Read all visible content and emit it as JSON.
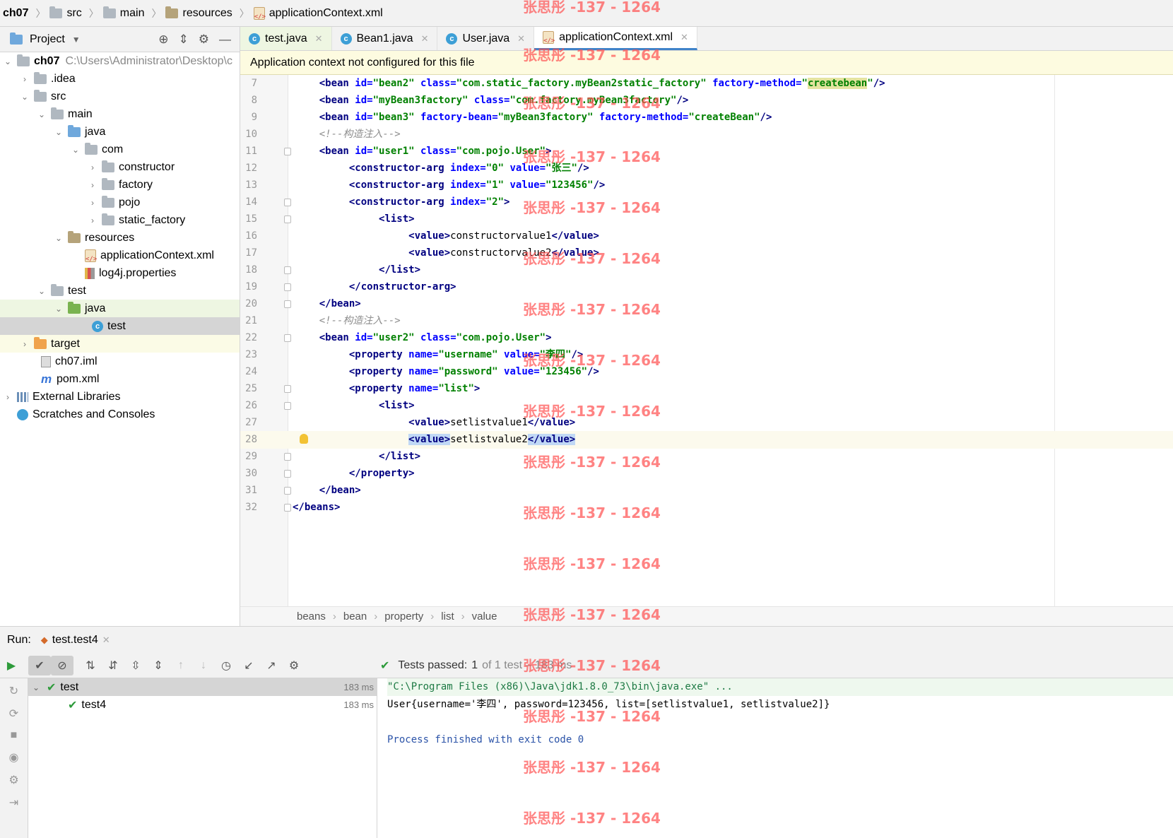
{
  "breadcrumb": {
    "items": [
      "ch07",
      "src",
      "main",
      "resources",
      "applicationContext.xml"
    ]
  },
  "project": {
    "title": "Project",
    "tree": [
      {
        "label": "ch07",
        "path": "C:\\Users\\Administrator\\Desktop\\c",
        "icon": "module-folder-icon"
      },
      {
        "label": ".idea",
        "icon": "folder-icon"
      },
      {
        "label": "src",
        "icon": "folder-icon"
      },
      {
        "label": "main",
        "icon": "folder-icon"
      },
      {
        "label": "java",
        "icon": "source-folder-icon"
      },
      {
        "label": "com",
        "icon": "package-icon"
      },
      {
        "label": "constructor",
        "icon": "package-icon"
      },
      {
        "label": "factory",
        "icon": "package-icon"
      },
      {
        "label": "pojo",
        "icon": "package-icon"
      },
      {
        "label": "static_factory",
        "icon": "package-icon"
      },
      {
        "label": "resources",
        "icon": "resources-folder-icon"
      },
      {
        "label": "applicationContext.xml",
        "icon": "xml-file-icon"
      },
      {
        "label": "log4j.properties",
        "icon": "properties-file-icon"
      },
      {
        "label": "test",
        "icon": "folder-icon"
      },
      {
        "label": "java",
        "icon": "test-source-folder-icon"
      },
      {
        "label": "test",
        "icon": "java-class-icon"
      },
      {
        "label": "target",
        "icon": "excluded-folder-icon"
      },
      {
        "label": "ch07.iml",
        "icon": "iml-file-icon"
      },
      {
        "label": "pom.xml",
        "icon": "maven-icon"
      },
      {
        "label": "External Libraries",
        "icon": "library-icon"
      },
      {
        "label": "Scratches and Consoles",
        "icon": "scratches-icon"
      }
    ]
  },
  "tabs": [
    {
      "label": "test.java"
    },
    {
      "label": "Bean1.java"
    },
    {
      "label": "User.java"
    },
    {
      "label": "applicationContext.xml"
    }
  ],
  "banner": {
    "text": "Application context not configured for this file"
  },
  "editor": {
    "lines": [
      {
        "n": "7"
      },
      {
        "n": "8"
      },
      {
        "n": "9"
      },
      {
        "n": "10"
      },
      {
        "n": "11"
      },
      {
        "n": "12"
      },
      {
        "n": "13"
      },
      {
        "n": "14"
      },
      {
        "n": "15"
      },
      {
        "n": "16"
      },
      {
        "n": "17"
      },
      {
        "n": "18"
      },
      {
        "n": "19"
      },
      {
        "n": "20"
      },
      {
        "n": "21"
      },
      {
        "n": "22"
      },
      {
        "n": "23"
      },
      {
        "n": "24"
      },
      {
        "n": "25"
      },
      {
        "n": "26"
      },
      {
        "n": "27"
      },
      {
        "n": "28"
      },
      {
        "n": "29"
      },
      {
        "n": "30"
      },
      {
        "n": "31"
      },
      {
        "n": "32"
      }
    ],
    "breadcrumbs": [
      "beans",
      "bean",
      "property",
      "list",
      "value"
    ]
  },
  "run": {
    "label": "Run:",
    "tab": "test.test4",
    "status_prefix": "Tests passed:",
    "status_count": "1",
    "status_rest": "of 1 test – 183 ms",
    "tests": [
      {
        "name": "test",
        "duration": "183 ms"
      },
      {
        "name": "test4",
        "duration": "183 ms"
      }
    ],
    "console": [
      "\"C:\\Program Files (x86)\\Java\\jdk1.8.0_73\\bin\\java.exe\" ...",
      "User{username='李四', password=123456, list=[setlistvalue1, setlistvalue2]}",
      "",
      "Process finished with exit code 0"
    ]
  },
  "watermark": "张思彤 -137 - 1264"
}
